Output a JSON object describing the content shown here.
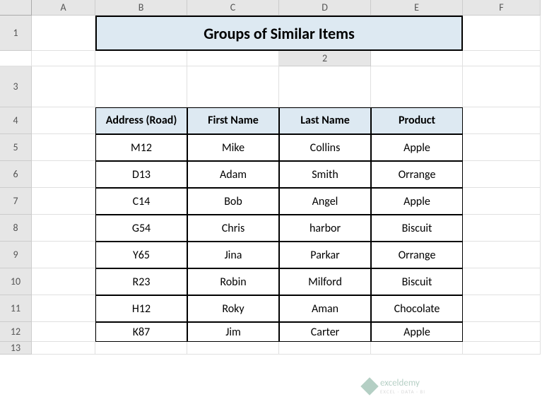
{
  "columns": [
    "A",
    "B",
    "C",
    "D",
    "E",
    "F"
  ],
  "rows": [
    "1",
    "2",
    "3",
    "4",
    "5",
    "6",
    "7",
    "8",
    "9",
    "10",
    "11",
    "12",
    "13"
  ],
  "title": "Groups of Similar Items",
  "headers": {
    "col1": "Address (Road)",
    "col2": "First Name",
    "col3": "Last Name",
    "col4": "Product"
  },
  "data": [
    {
      "address": "M12",
      "first": "Mike",
      "last": "Collins",
      "product": "Apple"
    },
    {
      "address": "D13",
      "first": "Adam",
      "last": "Smith",
      "product": "Orrange"
    },
    {
      "address": "C14",
      "first": "Bob",
      "last": "Angel",
      "product": "Apple"
    },
    {
      "address": "G54",
      "first": "Chris",
      "last": "harbor",
      "product": "Biscuit"
    },
    {
      "address": "Y65",
      "first": "Jina",
      "last": "Parkar",
      "product": "Orrange"
    },
    {
      "address": "R23",
      "first": "Robin",
      "last": "Milford",
      "product": "Biscuit"
    },
    {
      "address": "H12",
      "first": "Roky",
      "last": "Aman",
      "product": "Chocolate"
    },
    {
      "address": "K87",
      "first": "Jim",
      "last": "Carter",
      "product": "Apple"
    }
  ],
  "watermark": {
    "brand": "exceldemy",
    "sub": "EXCEL · DATA · BI"
  },
  "chart_data": {
    "type": "table",
    "title": "Groups of Similar Items",
    "columns": [
      "Address (Road)",
      "First Name",
      "Last Name",
      "Product"
    ],
    "rows": [
      [
        "M12",
        "Mike",
        "Collins",
        "Apple"
      ],
      [
        "D13",
        "Adam",
        "Smith",
        "Orrange"
      ],
      [
        "C14",
        "Bob",
        "Angel",
        "Apple"
      ],
      [
        "G54",
        "Chris",
        "harbor",
        "Biscuit"
      ],
      [
        "Y65",
        "Jina",
        "Parkar",
        "Orrange"
      ],
      [
        "R23",
        "Robin",
        "Milford",
        "Biscuit"
      ],
      [
        "H12",
        "Roky",
        "Aman",
        "Chocolate"
      ],
      [
        "K87",
        "Jim",
        "Carter",
        "Apple"
      ]
    ]
  }
}
